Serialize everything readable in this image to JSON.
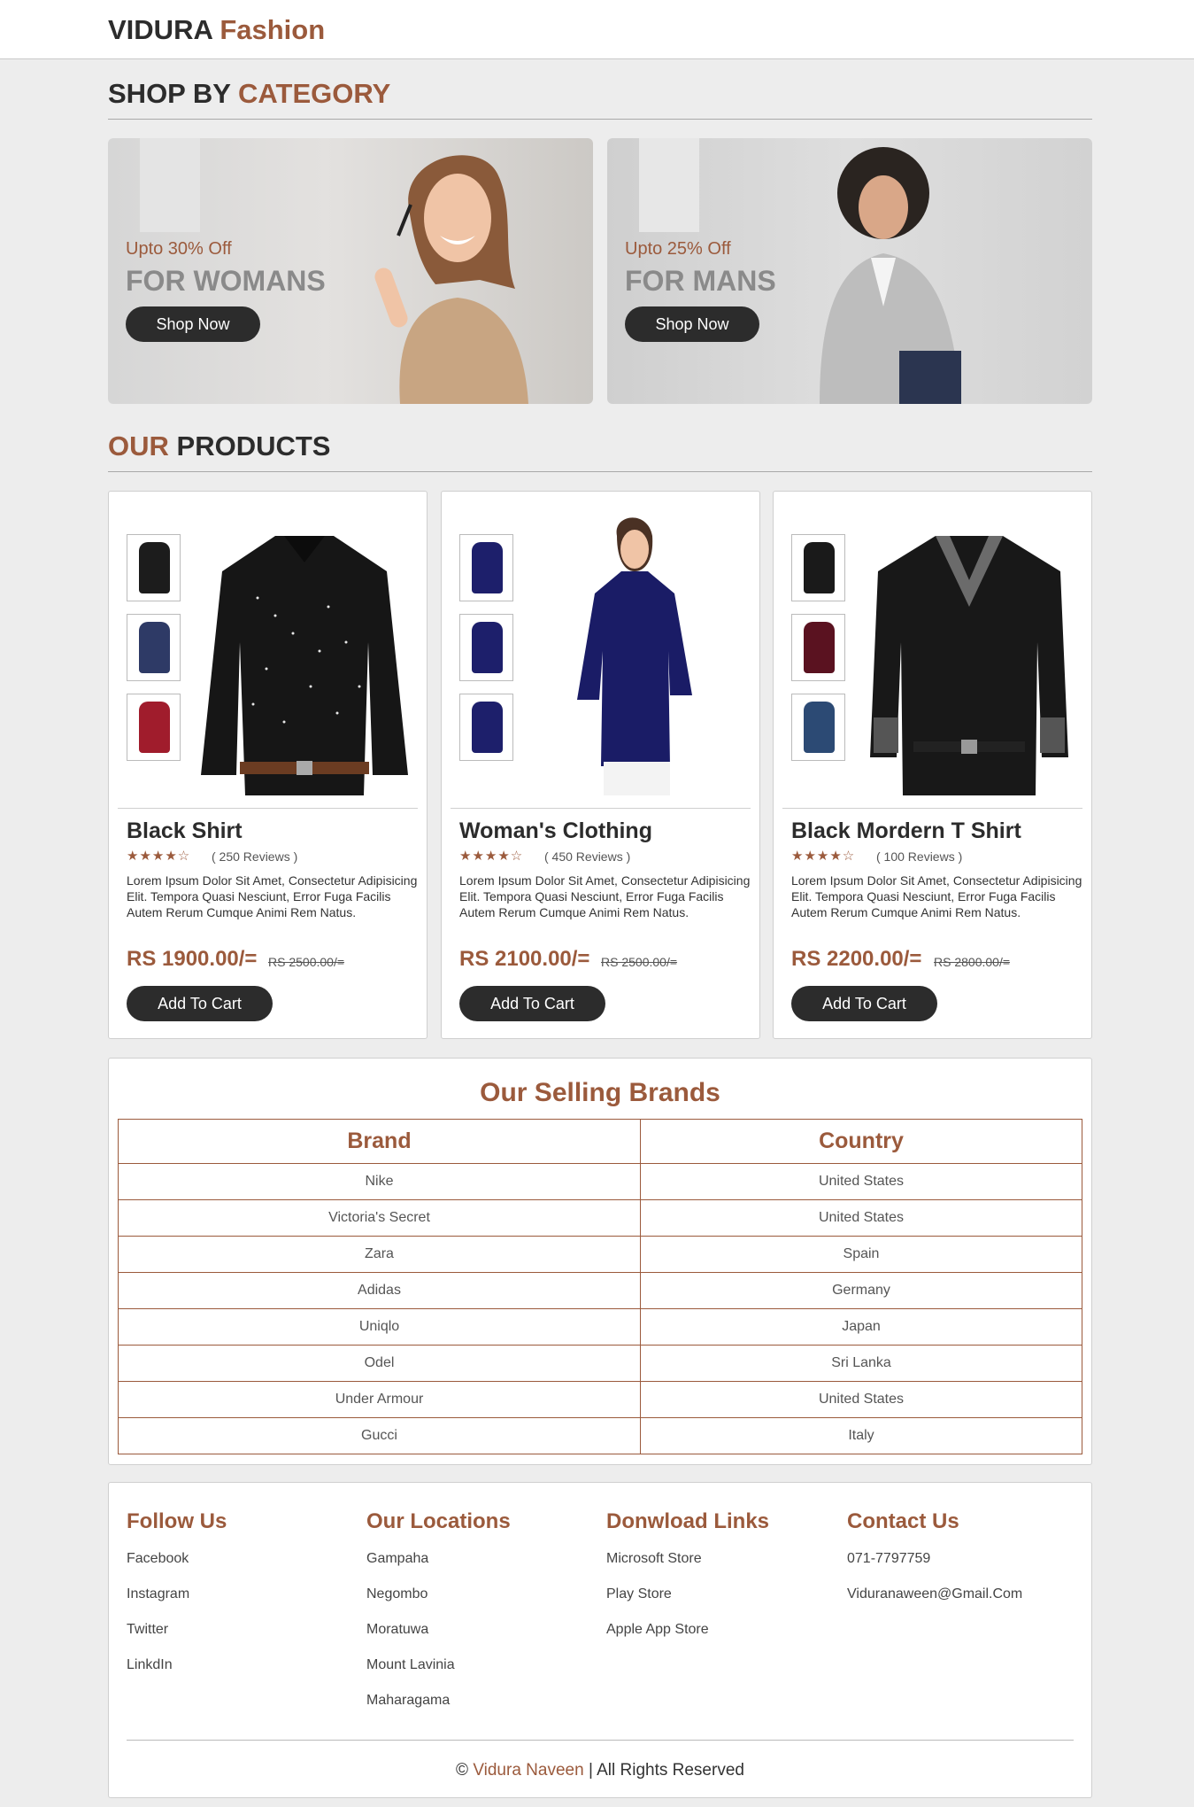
{
  "header": {
    "logo_main": "VIDURA",
    "logo_accent": "Fashion"
  },
  "category": {
    "title_main": "SHOP BY",
    "title_accent": "CATEGORY",
    "banners": [
      {
        "offer": "Upto 30% Off",
        "label": "FOR WOMANS",
        "button": "Shop Now"
      },
      {
        "offer": "Upto 25% Off",
        "label": "FOR MANS",
        "button": "Shop Now"
      }
    ]
  },
  "products_section": {
    "title_accent": "OUR",
    "title_main": "PRODUCTS",
    "items": [
      {
        "name": "Black Shirt",
        "stars": "★★★★☆",
        "reviews": "( 250 Reviews )",
        "description": "Lorem Ipsum Dolor Sit Amet, Consectetur Adipisicing Elit. Tempora Quasi Nesciunt, Error Fuga Facilis Autem Rerum Cumque Animi Rem Natus.",
        "price": "RS 1900.00/=",
        "old_price": "RS 2500.00/=",
        "button": "Add To Cart",
        "colors": [
          "#1c1c1c",
          "#2e3a66",
          "#a01c2c"
        ]
      },
      {
        "name": "Woman's Clothing",
        "stars": "★★★★☆",
        "reviews": "( 450 Reviews )",
        "description": "Lorem Ipsum Dolor Sit Amet, Consectetur Adipisicing Elit. Tempora Quasi Nesciunt, Error Fuga Facilis Autem Rerum Cumque Animi Rem Natus.",
        "price": "RS 2100.00/=",
        "old_price": "RS 2500.00/=",
        "button": "Add To Cart",
        "colors": [
          "#1d1f6b",
          "#1d1f6b",
          "#1d1f6b"
        ]
      },
      {
        "name": "Black Mordern T Shirt",
        "stars": "★★★★☆",
        "reviews": "( 100 Reviews )",
        "description": "Lorem Ipsum Dolor Sit Amet, Consectetur Adipisicing Elit. Tempora Quasi Nesciunt, Error Fuga Facilis Autem Rerum Cumque Animi Rem Natus.",
        "price": "RS 2200.00/=",
        "old_price": "RS 2800.00/=",
        "button": "Add To Cart",
        "colors": [
          "#1a1a1a",
          "#5a1220",
          "#2c4a74"
        ]
      }
    ]
  },
  "brands": {
    "title": "Our Selling Brands",
    "headers": [
      "Brand",
      "Country"
    ],
    "rows": [
      [
        "Nike",
        "United States"
      ],
      [
        "Victoria's Secret",
        "United States"
      ],
      [
        "Zara",
        "Spain"
      ],
      [
        "Adidas",
        "Germany"
      ],
      [
        "Uniqlo",
        "Japan"
      ],
      [
        "Odel",
        "Sri Lanka"
      ],
      [
        "Under Armour",
        "United States"
      ],
      [
        "Gucci",
        "Italy"
      ]
    ]
  },
  "footer": {
    "columns": [
      {
        "title": "Follow Us",
        "links": [
          "Facebook",
          "Instagram",
          "Twitter",
          "LinkdIn"
        ]
      },
      {
        "title": "Our Locations",
        "links": [
          "Gampaha",
          "Negombo",
          "Moratuwa",
          "Mount Lavinia",
          "Maharagama"
        ]
      },
      {
        "title": "Donwload Links",
        "links": [
          "Microsoft Store",
          "Play Store",
          "Apple App Store"
        ]
      },
      {
        "title": "Contact Us",
        "links": [
          "071-7797759",
          "Viduranaween@Gmail.Com"
        ]
      }
    ],
    "copyright_symbol": "©",
    "copyright_name": "Vidura Naveen",
    "copyright_rest": "| All Rights Reserved"
  },
  "colors": {
    "accent": "#9b5a3c",
    "dark": "#2c2c2c",
    "background": "#ededed"
  }
}
